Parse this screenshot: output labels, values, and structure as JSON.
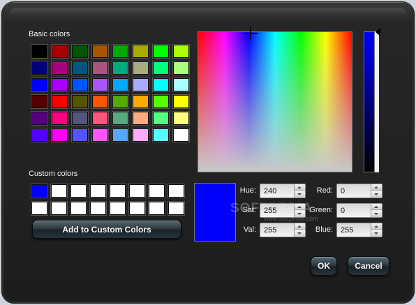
{
  "labels": {
    "basic_colors": "Basic colors",
    "custom_colors": "Custom colors"
  },
  "basic_colors": [
    "#000000",
    "#aa0000",
    "#005500",
    "#aa5500",
    "#00aa00",
    "#aaaa00",
    "#00ff00",
    "#aaff00",
    "#00007f",
    "#aa007f",
    "#00557f",
    "#aa557f",
    "#00aa7f",
    "#aaaa7f",
    "#00ff7f",
    "#aaff7f",
    "#0000ff",
    "#aa00ff",
    "#0055ff",
    "#aa55ff",
    "#00aaff",
    "#aaaaff",
    "#00ffff",
    "#aaffff",
    "#550000",
    "#ff0000",
    "#555500",
    "#ff5500",
    "#55aa00",
    "#ffaa00",
    "#55ff00",
    "#ffff00",
    "#55007f",
    "#ff007f",
    "#55557f",
    "#ff557f",
    "#55aa7f",
    "#ffaa7f",
    "#55ff7f",
    "#ffff7f",
    "#5500ff",
    "#ff00ff",
    "#5555ff",
    "#ff55ff",
    "#55aaff",
    "#ffaaff",
    "#55ffff",
    "#ffffff"
  ],
  "custom_colors": [
    "#0000ff",
    "#ffffff",
    "#ffffff",
    "#ffffff",
    "#ffffff",
    "#ffffff",
    "#ffffff",
    "#ffffff",
    "#ffffff",
    "#ffffff",
    "#ffffff",
    "#ffffff",
    "#ffffff",
    "#ffffff",
    "#ffffff",
    "#ffffff"
  ],
  "current_color": "#0000ff",
  "fields": {
    "hue": {
      "label": "Hue:",
      "value": "240"
    },
    "sat": {
      "label": "Sat:",
      "value": "255"
    },
    "val": {
      "label": "Val:",
      "value": "255"
    },
    "red": {
      "label": "Red:",
      "value": "0"
    },
    "green": {
      "label": "Green:",
      "value": "0"
    },
    "blue": {
      "label": "Blue:",
      "value": "255"
    }
  },
  "buttons": {
    "add_custom": "Add to Custom Colors",
    "ok": "OK",
    "cancel": "Cancel"
  },
  "watermark": {
    "text": "SOFTPEDIA",
    "sub": "www.softpedia.com"
  }
}
